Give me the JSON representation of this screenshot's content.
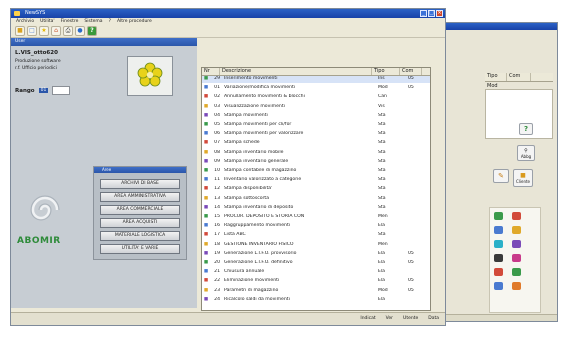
{
  "back_window": {
    "col_tipo": "Tipo",
    "col_com": "Com",
    "sub_header": "Mod",
    "btn_abbg": "Abbg",
    "btn_cliente": "Cliente",
    "btn_help": "?"
  },
  "main_window": {
    "title": "NewSYS",
    "menu": [
      "Archivio",
      "Utilita'",
      "Finestre",
      "Sistema",
      "?",
      "Altre procedure"
    ],
    "toolbar_icons": [
      "open-folder-icon",
      "new-document-icon",
      "star-icon",
      "home-icon",
      "print-icon",
      "globe-icon",
      "help-icon"
    ],
    "panel_strip": "User",
    "user_name": "L.VIS_otto620",
    "user_line2": "Produzione software",
    "user_line3": "r.f. Ufficio periodici",
    "regs_label": "Rango",
    "regs_value": "01",
    "logo_text": "ABOMIR",
    "menu_panel_title": "Aree",
    "area_buttons": [
      "ARCHIVI DI BASE",
      "AREA AMMINISTRATIVA",
      "AREA COMMERCIALE",
      "AREA ACQUISTI",
      "MATERIALE LOGISTICA",
      "UTILITA' E VARIE"
    ],
    "list_columns": [
      "Nr",
      "Descrizione",
      "Tipo",
      "Com"
    ],
    "rows": [
      {
        "num": "29",
        "desc": "Inserimento movimenti",
        "tipo": "Ins",
        "com": "05"
      },
      {
        "num": "01",
        "desc": "Variazione/modifica movimenti",
        "tipo": "Mod",
        "com": "05"
      },
      {
        "num": "02",
        "desc": "Annullamento movimenti & blocchi",
        "tipo": "Can",
        "com": ""
      },
      {
        "num": "03",
        "desc": "Visualizzazione movimenti",
        "tipo": "Vis",
        "com": ""
      },
      {
        "num": "04",
        "desc": "Stampa movimenti",
        "tipo": "Sta",
        "com": ""
      },
      {
        "num": "05",
        "desc": "Stampa movimenti per cli/for",
        "tipo": "Sta",
        "com": ""
      },
      {
        "num": "06",
        "desc": "Stampa movimenti per valorizzare",
        "tipo": "Sta",
        "com": ""
      },
      {
        "num": "07",
        "desc": "Stampa schede",
        "tipo": "Sta",
        "com": ""
      },
      {
        "num": "08",
        "desc": "Stampa inventario mobile",
        "tipo": "Sta",
        "com": ""
      },
      {
        "num": "09",
        "desc": "Stampa inventario generale",
        "tipo": "Sta",
        "com": ""
      },
      {
        "num": "10",
        "desc": "Stampa contabile di magazzino",
        "tipo": "Sta",
        "com": ""
      },
      {
        "num": "11",
        "desc": "Inventario valorizzato a categorie",
        "tipo": "Sta",
        "com": ""
      },
      {
        "num": "12",
        "desc": "Stampa disponibilita'",
        "tipo": "Sta",
        "com": ""
      },
      {
        "num": "13",
        "desc": "Stampa sottoscorta",
        "tipo": "Sta",
        "com": ""
      },
      {
        "num": "14",
        "desc": "Stampa inventario di deposito",
        "tipo": "Sta",
        "com": ""
      },
      {
        "num": "15",
        "desc": "PROCUR. DEPOSITO E STORIA CON",
        "tipo": "Men",
        "com": ""
      },
      {
        "num": "16",
        "desc": "Raggruppamento movimenti",
        "tipo": "Ela",
        "com": ""
      },
      {
        "num": "17",
        "desc": "Lista ABC",
        "tipo": "Sta",
        "com": ""
      },
      {
        "num": "18",
        "desc": "GESTIONE INVENTARIO FISICO",
        "tipo": "Men",
        "com": ""
      },
      {
        "num": "19",
        "desc": "Generazione L.I.F.O. provvisorio",
        "tipo": "Ela",
        "com": "05"
      },
      {
        "num": "20",
        "desc": "Generazione L.I.F.O. definitivo",
        "tipo": "Ela",
        "com": "05"
      },
      {
        "num": "21",
        "desc": "Chiusura annuale",
        "tipo": "Ela",
        "com": ""
      },
      {
        "num": "22",
        "desc": "Eliminazione movimenti",
        "tipo": "Ela",
        "com": "05"
      },
      {
        "num": "23",
        "desc": "Parametri di magazzino",
        "tipo": "Mod",
        "com": "05"
      },
      {
        "num": "24",
        "desc": "Ricalcolo saldi da movimenti",
        "tipo": "Ela",
        "com": ""
      }
    ],
    "status_items": [
      "Indicat",
      "Ver",
      "Utente",
      "Data"
    ]
  },
  "colors": {
    "title_bar": "#2458bf",
    "panel_bg": "#c7cdd3",
    "logo_green": "#2e8b3a",
    "logo_red": "#c8282a"
  }
}
